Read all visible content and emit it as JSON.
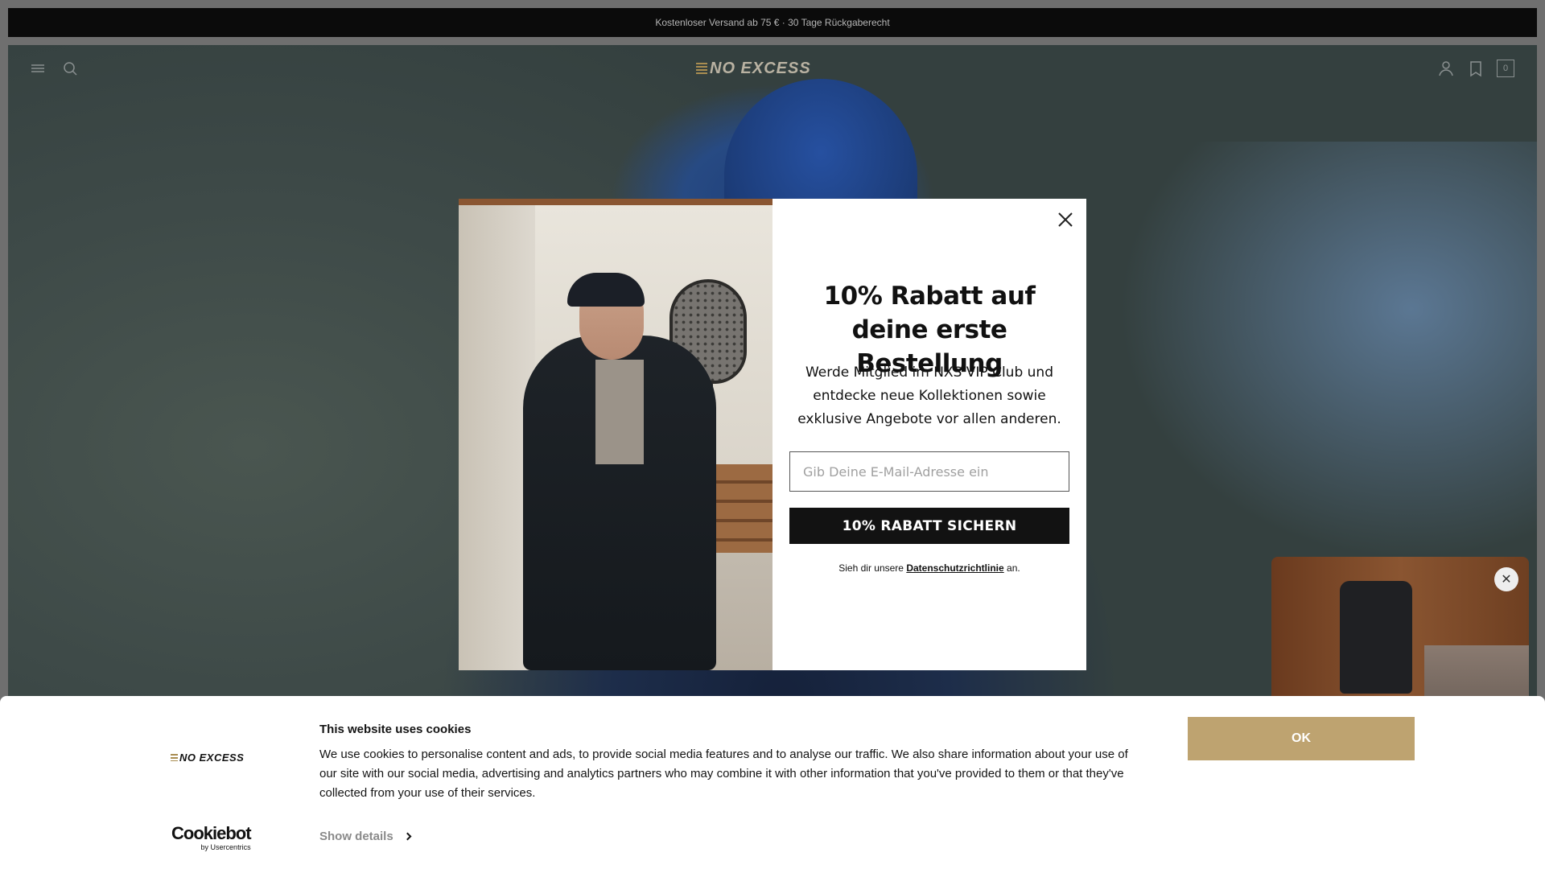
{
  "announcement": {
    "text": "Kostenloser Versand ab 75 € · 30 Tage Rückgaberecht"
  },
  "header": {
    "logo_text": "NO EXCESS",
    "cart_count": "0",
    "icons": [
      "menu-icon",
      "search-icon",
      "account-icon",
      "wishlist-icon",
      "cart-icon"
    ]
  },
  "newsletter_modal": {
    "title": "10% Rabatt auf deine erste Bestellung",
    "description": "Werde Mitglied im NXS VIP Club und entdecke neue Kollektionen sowie exklusive Angebote vor allen anderen.",
    "email_placeholder": "Gib Deine E-Mail-Adresse ein",
    "cta_label": "10% RABATT SICHERN",
    "privacy_prefix": "Sieh dir unsere",
    "privacy_link": "Datenschutzrichtlinie",
    "privacy_suffix": "an.",
    "close_icon": "close-icon"
  },
  "video_teaser": {
    "close_symbol": "✕"
  },
  "cookie_banner": {
    "logo_text": "NO EXCESS",
    "title": "This website uses cookies",
    "text": "We use cookies to personalise content and ads, to provide social media features and to analyse our traffic. We also share information about your use of our site with our social media, advertising and analytics partners who may combine it with other information that you've provided to them or that they've collected from your use of their services.",
    "show_details_label": "Show details",
    "ok_label": "OK",
    "provider_name": "Cookiebot",
    "provider_sub": "by Usercentrics"
  },
  "colors": {
    "accent_gold": "#bea370",
    "dark": "#121212",
    "overlay": "#6f6f6f"
  }
}
